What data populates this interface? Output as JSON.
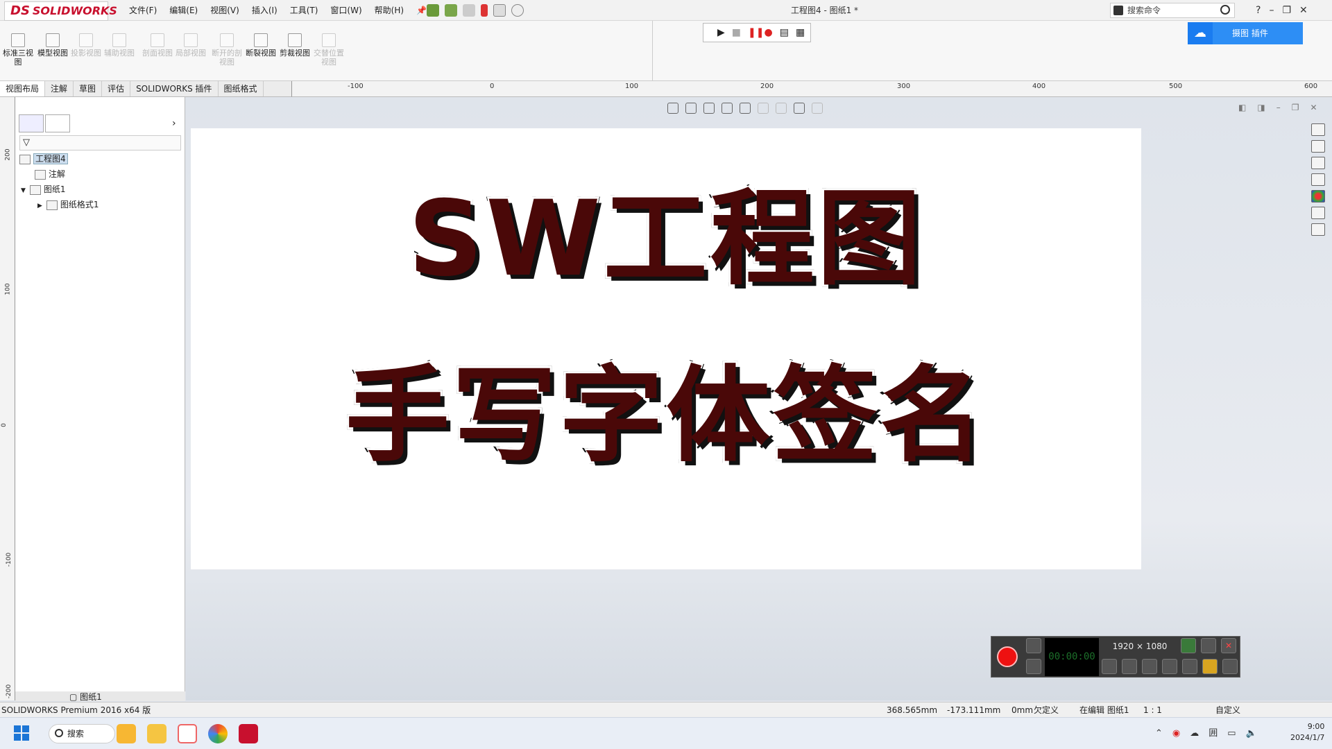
{
  "app": {
    "logo_symbol": "DS",
    "logo_text": "SOLIDWORKS",
    "doc_title": "工程图4 - 图纸1 *"
  },
  "menu": [
    "文件(F)",
    "编辑(E)",
    "视图(V)",
    "插入(I)",
    "工具(T)",
    "窗口(W)",
    "帮助(H)"
  ],
  "search": {
    "placeholder": "搜索命令"
  },
  "window_buttons": {
    "help": "?",
    "minimize": "–",
    "restore": "❐",
    "close": "✕"
  },
  "ribbon": [
    {
      "label": "标准三视图",
      "enabled": true
    },
    {
      "label": "模型视图",
      "enabled": true
    },
    {
      "label": "投影视图",
      "enabled": false
    },
    {
      "label": "辅助视图",
      "enabled": false
    },
    {
      "label": "剖面视图",
      "enabled": false
    },
    {
      "label": "局部视图",
      "enabled": false
    },
    {
      "label": "断开的剖视图",
      "enabled": false
    },
    {
      "label": "断裂视图",
      "enabled": true
    },
    {
      "label": "剪裁视图",
      "enabled": true
    },
    {
      "label": "交替位置视图",
      "enabled": false
    }
  ],
  "macro_bar": {
    "play": "▶",
    "stop": "■",
    "record": "❚❚●",
    "doc1": "▤",
    "doc2": "▦"
  },
  "cloud": {
    "icon": "☁",
    "label": "摄图 插件"
  },
  "command_tabs": [
    {
      "label": "视图布局",
      "active": true
    },
    {
      "label": "注解",
      "active": false
    },
    {
      "label": "草图",
      "active": false
    },
    {
      "label": "评估",
      "active": false
    },
    {
      "label": "SOLIDWORKS 插件",
      "active": false
    },
    {
      "label": "图纸格式",
      "active": false
    }
  ],
  "h_ruler": [
    "-100",
    "0",
    "100",
    "200",
    "300",
    "400",
    "500",
    "600"
  ],
  "v_ruler": [
    "200",
    "100",
    "0",
    "-100",
    "-200"
  ],
  "feature_tree": [
    {
      "label": "工程图4",
      "level": 0,
      "selected": true,
      "icon": "drawing-icon"
    },
    {
      "label": "注解",
      "level": 1,
      "selected": false,
      "icon": "annotation-icon"
    },
    {
      "label": "图纸1",
      "level": 1,
      "selected": false,
      "icon": "sheet-icon",
      "expanded": true
    },
    {
      "label": "图纸格式1",
      "level": 2,
      "selected": false,
      "icon": "sheet-format-icon",
      "expanded": false
    }
  ],
  "panel_chevron": "›",
  "canvas": {
    "line1": "SW工程图",
    "line2": "手写字体签名"
  },
  "recorder": {
    "counter": "00:00:00",
    "resolution": "1920 × 1080"
  },
  "sheet_tab": "图纸1",
  "status": {
    "product": "SOLIDWORKS Premium 2016 x64 版",
    "x": "368.565mm",
    "y": "-173.111mm",
    "z": "0mm",
    "state": "欠定义",
    "editing": "在编辑 图纸1",
    "scale": "1 : 1",
    "units": "自定义"
  },
  "taskbar": {
    "search": "搜索",
    "time": "9:00",
    "date": "2024/1/7"
  },
  "colors": {
    "brand": "#c8102e",
    "text_fill": "#4a0808",
    "record": "#e11111",
    "cloud": "#1a7cf0"
  }
}
